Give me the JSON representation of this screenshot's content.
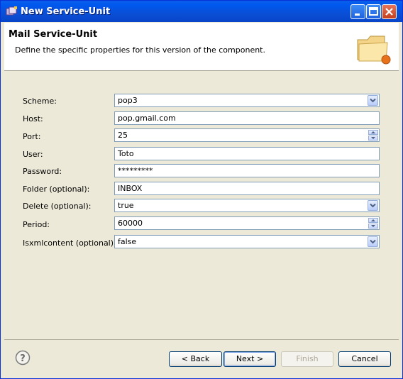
{
  "window": {
    "title": "New Service-Unit"
  },
  "header": {
    "title": "Mail Service-Unit",
    "description": "Define the specific properties for this version of the component."
  },
  "form": {
    "scheme": {
      "label": "Scheme:",
      "value": "pop3"
    },
    "host": {
      "label": "Host:",
      "value": "pop.gmail.com"
    },
    "port": {
      "label": "Port:",
      "value": "25"
    },
    "user": {
      "label": "User:",
      "value": "Toto"
    },
    "password": {
      "label": "Password:",
      "value": "*********"
    },
    "folder": {
      "label": "Folder (optional):",
      "value": "INBOX"
    },
    "delete": {
      "label": "Delete (optional):",
      "value": "true"
    },
    "period": {
      "label": "Period:",
      "value": "60000"
    },
    "isxmlcontent": {
      "label": "Isxmlcontent (optional):",
      "value": "false"
    }
  },
  "buttons": {
    "back": "< Back",
    "next": "Next >",
    "finish": "Finish",
    "cancel": "Cancel"
  },
  "icons": {
    "app": "eclipse-wizard-icon",
    "help": "help-icon",
    "banner": "folder-icon"
  }
}
